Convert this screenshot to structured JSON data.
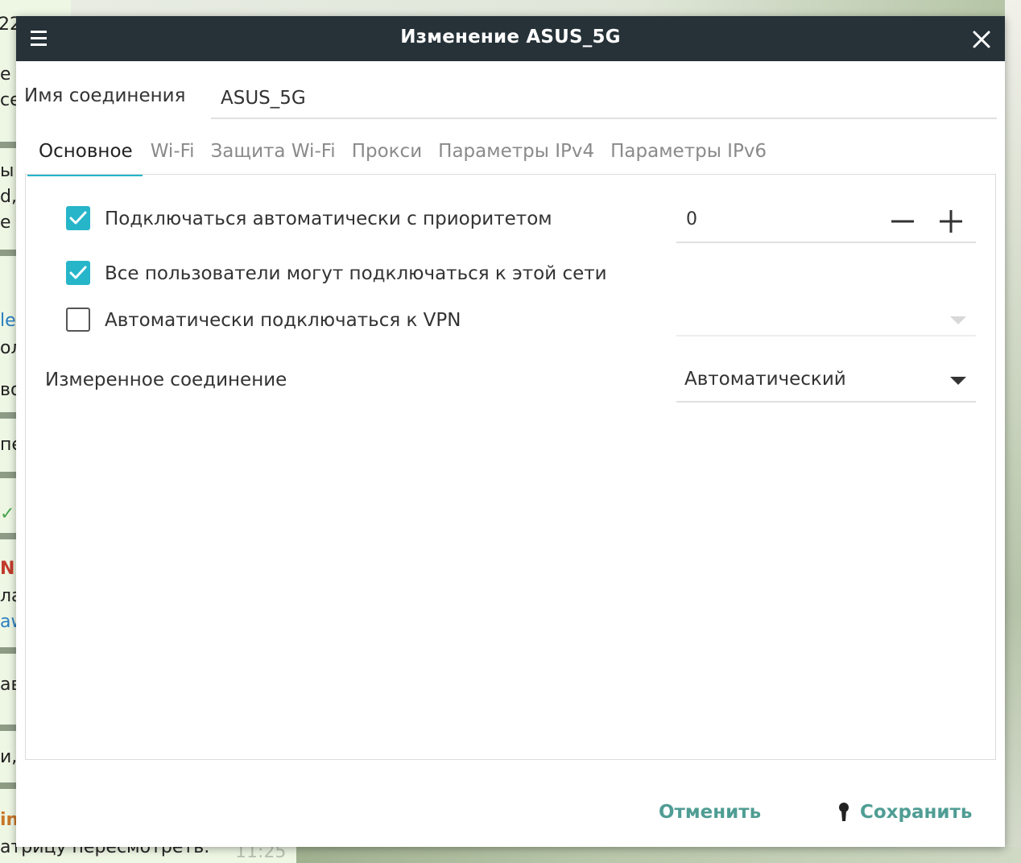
{
  "background": {
    "fragments": [
      {
        "text": "22",
        "style": "green"
      },
      {
        "text": "е",
        "style": ""
      },
      {
        "text": "се",
        "style": ""
      },
      {
        "text": "ы",
        "style": ""
      },
      {
        "text": "d,",
        "style": ""
      },
      {
        "text": "е н",
        "style": ""
      },
      {
        "text": "le",
        "style": "link"
      },
      {
        "text": "ол",
        "style": ""
      },
      {
        "text": "во",
        "style": ""
      },
      {
        "text": "пе",
        "style": ""
      },
      {
        "text": "✓",
        "style": "green"
      },
      {
        "text": "N",
        "style": "red"
      },
      {
        "text": "ла",
        "style": ""
      },
      {
        "text": "aw",
        "style": "link"
      },
      {
        "text": "ав",
        "style": ""
      },
      {
        "text": "и, н",
        "style": ""
      },
      {
        "text": "in",
        "style": "orange"
      },
      {
        "text": "атрицу пересмотреть.",
        "style": ""
      },
      {
        "text": "11:25",
        "style": "grey"
      }
    ]
  },
  "dialog": {
    "title": "Изменение ASUS_5G",
    "menu_icon": "hamburger-menu-icon",
    "close_icon": "close-icon",
    "connection_name_label": "Имя соединения",
    "connection_name_value": "ASUS_5G",
    "tabs": [
      {
        "label": "Основное",
        "active": true
      },
      {
        "label": "Wi-Fi",
        "active": false
      },
      {
        "label": "Защита Wi-Fi",
        "active": false
      },
      {
        "label": "Прокси",
        "active": false
      },
      {
        "label": "Параметры IPv4",
        "active": false
      },
      {
        "label": "Параметры IPv6",
        "active": false
      }
    ],
    "general": {
      "auto_connect": {
        "label": "Подключаться автоматически с приоритетом",
        "checked": true
      },
      "priority_value": "0",
      "all_users": {
        "label": "Все пользователи могут подключаться к этой сети",
        "checked": true
      },
      "auto_vpn": {
        "label": "Автоматически подключаться к VPN",
        "checked": false
      },
      "vpn_selected": "",
      "metered_label": "Измеренное соединение",
      "metered_value": "Автоматический"
    },
    "footer": {
      "cancel_label": "Отменить",
      "save_label": "Сохранить"
    }
  },
  "colors": {
    "titlebar": "#263238",
    "accent": "#26b5c9",
    "button_text": "#4f9d94"
  }
}
